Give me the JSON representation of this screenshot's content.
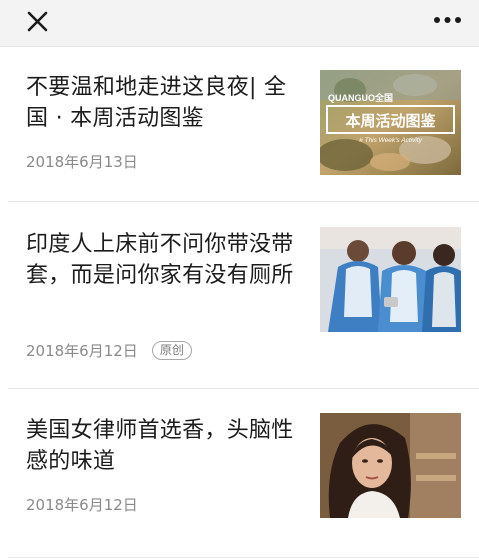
{
  "toolbar": {
    "close_icon": "close-icon",
    "more_icon": "more-icon"
  },
  "articles": [
    {
      "title": "不要温和地走进这良夜| 全国 · 本周活动图鉴",
      "date": "2018年6月13日",
      "badge": "",
      "thumbnail": {
        "brand": "QUANGUO全国",
        "caption": "本周活动图鉴",
        "subcaption": "# This Week's Activity"
      }
    },
    {
      "title": "印度人上床前不问你带没带套，而是问你家有没有厕所",
      "date": "2018年6月12日",
      "badge": "原创",
      "thumbnail": {}
    },
    {
      "title": "美国女律师首选香，头脑性感的味道",
      "date": "2018年6月12日",
      "badge": "",
      "thumbnail": {}
    }
  ],
  "colors": {
    "topbar_bg": "#f3f3f3",
    "title_text": "#1c1c1c",
    "meta_text": "#8a8a8a",
    "divider": "#e8e8e8"
  }
}
